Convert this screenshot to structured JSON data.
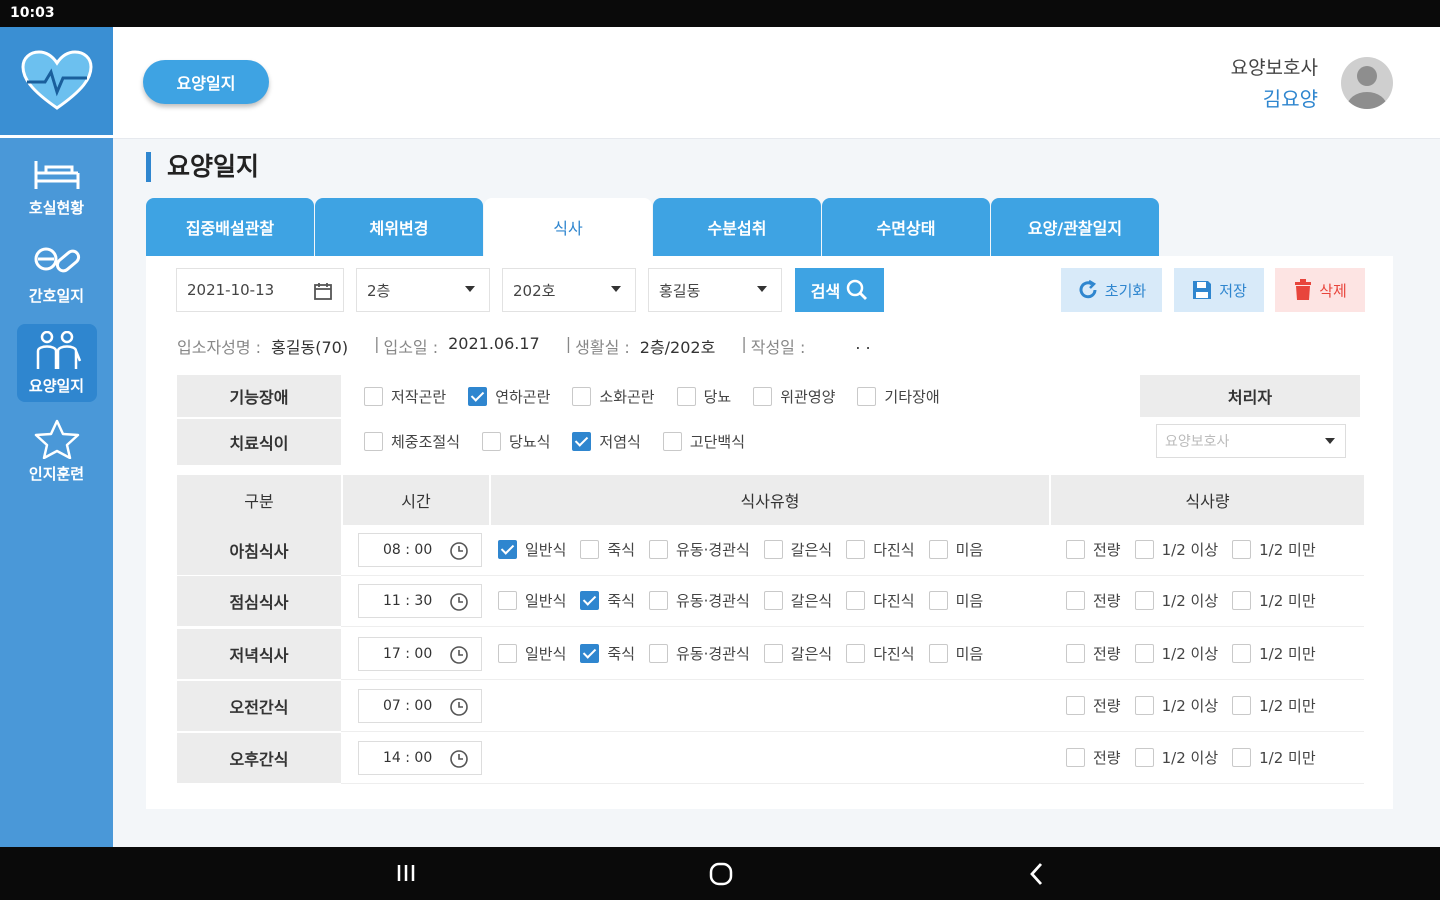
{
  "status_bar": {
    "time": "10:03"
  },
  "sidebar": {
    "items": [
      {
        "label": "호실현황",
        "icon": "bed-icon",
        "active": false
      },
      {
        "label": "간호일지",
        "icon": "pill-icon",
        "active": false
      },
      {
        "label": "요양일지",
        "icon": "caregiver-icon",
        "active": true
      },
      {
        "label": "인지훈련",
        "icon": "star-icon",
        "active": false
      }
    ]
  },
  "header": {
    "chip_label": "요양일지",
    "user_role": "요양보호사",
    "user_name": "김요양"
  },
  "page": {
    "title": "요양일지"
  },
  "tabs": [
    {
      "label": "집중배설관찰",
      "active": false
    },
    {
      "label": "체위변경",
      "active": false
    },
    {
      "label": "식사",
      "active": true
    },
    {
      "label": "수분섭취",
      "active": false
    },
    {
      "label": "수면상태",
      "active": false
    },
    {
      "label": "요양/관찰일지",
      "active": false
    }
  ],
  "filters": {
    "date": "2021-10-13",
    "floor": "2층",
    "room": "202호",
    "resident": "홍길동",
    "search_label": "검색"
  },
  "actions": {
    "reset_label": "초기화",
    "save_label": "저장",
    "delete_label": "삭제"
  },
  "info": {
    "name_label": "입소자성명 :",
    "name_value": "홍길동(70)",
    "admit_label": "입소일 :",
    "admit_value": "2021.06.17",
    "room_label": "생활실 :",
    "room_value": "2층/202호",
    "writer_label": "작성일 :",
    "writer_value": ". ."
  },
  "function": {
    "disability_label": "기능장애",
    "disability_options": [
      {
        "label": "저작곤란",
        "checked": false
      },
      {
        "label": "연하곤란",
        "checked": true
      },
      {
        "label": "소화곤란",
        "checked": false
      },
      {
        "label": "당뇨",
        "checked": false
      },
      {
        "label": "위관영양",
        "checked": false
      },
      {
        "label": "기타장애",
        "checked": false
      }
    ],
    "diet_label": "치료식이",
    "diet_options": [
      {
        "label": "체중조절식",
        "checked": false
      },
      {
        "label": "당뇨식",
        "checked": false
      },
      {
        "label": "저염식",
        "checked": true
      },
      {
        "label": "고단백식",
        "checked": false
      }
    ],
    "handler_label": "처리자",
    "handler_placeholder": "요양보호사"
  },
  "meal_table": {
    "headers": [
      "구분",
      "시간",
      "식사유형",
      "식사량"
    ],
    "type_options": [
      "일반식",
      "죽식",
      "유동·경관식",
      "갈은식",
      "다진식",
      "미음"
    ],
    "amount_options": [
      "전량",
      "1/2 이상",
      "1/2 미만"
    ],
    "rows": [
      {
        "label": "아침식사",
        "time": "08 : 00",
        "type_checked": "일반식",
        "has_types": true
      },
      {
        "label": "점심식사",
        "time": "11 : 30",
        "type_checked": "죽식",
        "has_types": true
      },
      {
        "label": "저녁식사",
        "time": "17 : 00",
        "type_checked": "죽식",
        "has_types": true
      },
      {
        "label": "오전간식",
        "time": "07 : 00",
        "type_checked": "",
        "has_types": false
      },
      {
        "label": "오후간식",
        "time": "14 : 00",
        "type_checked": "",
        "has_types": false
      }
    ]
  },
  "colors": {
    "primary": "#3ea3e3",
    "sidebar": "#4a98d8",
    "accent": "#2f86cf",
    "delete": "#e8453c"
  }
}
